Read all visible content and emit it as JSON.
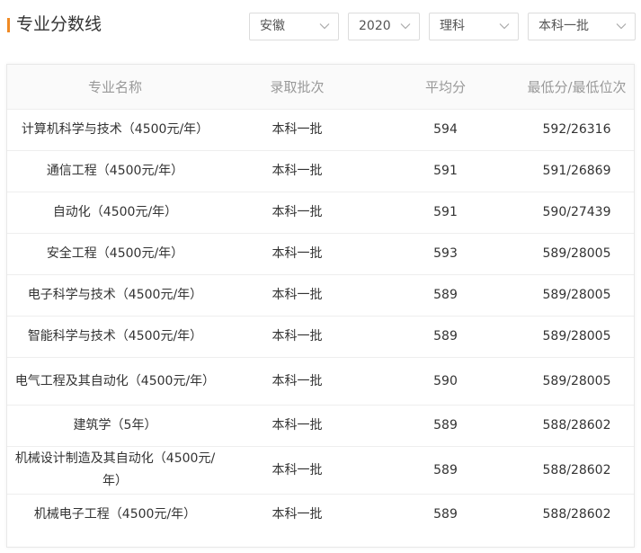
{
  "header": {
    "title": "专业分数线",
    "accent_color": "#f08a24",
    "filters": {
      "province": "安徽",
      "year": "2020",
      "subject": "理科",
      "batch": "本科一批"
    },
    "chevron_icon": "chevron-down-icon"
  },
  "table": {
    "columns": [
      "专业名称",
      "录取批次",
      "平均分",
      "最低分/最低位次"
    ],
    "rows": [
      {
        "name": "计算机科学与技术（4500元/年）",
        "batch": "本科一批",
        "avg": "594",
        "min": "592/26316"
      },
      {
        "name": "通信工程（4500元/年）",
        "batch": "本科一批",
        "avg": "591",
        "min": "591/26869"
      },
      {
        "name": "自动化（4500元/年）",
        "batch": "本科一批",
        "avg": "591",
        "min": "590/27439"
      },
      {
        "name": "安全工程（4500元/年）",
        "batch": "本科一批",
        "avg": "593",
        "min": "589/28005"
      },
      {
        "name": "电子科学与技术（4500元/年）",
        "batch": "本科一批",
        "avg": "589",
        "min": "589/28005"
      },
      {
        "name": "智能科学与技术（4500元/年）",
        "batch": "本科一批",
        "avg": "589",
        "min": "589/28005"
      },
      {
        "name": "电气工程及其自动化（4500元/年）",
        "batch": "本科一批",
        "avg": "590",
        "min": "589/28005"
      },
      {
        "name": "建筑学（5年）",
        "batch": "本科一批",
        "avg": "589",
        "min": "588/28602"
      },
      {
        "name": "机械设计制造及其自动化（4500元/年）",
        "batch": "本科一批",
        "avg": "589",
        "min": "588/28602"
      },
      {
        "name": "机械电子工程（4500元/年）",
        "batch": "本科一批",
        "avg": "589",
        "min": "588/28602"
      }
    ]
  }
}
